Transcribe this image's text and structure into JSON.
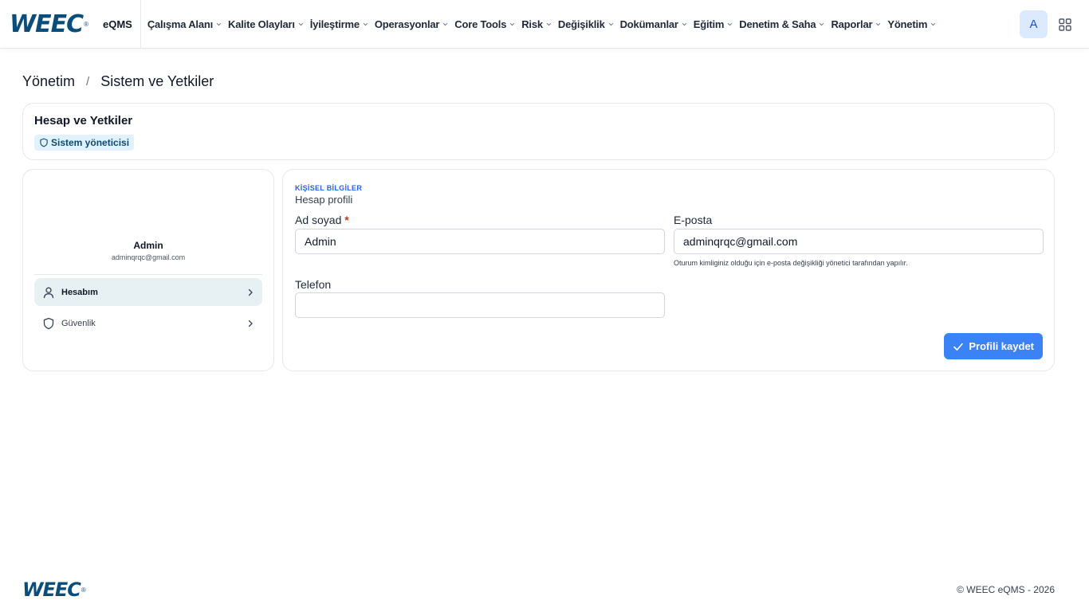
{
  "brand": {
    "logo": "WEEC",
    "app_name": "eQMS"
  },
  "nav": {
    "items": [
      "Çalışma Alanı",
      "Kalite Olayları",
      "İyileştirme",
      "Operasyonlar",
      "Core Tools",
      "Risk",
      "Değişiklik",
      "Dokümanlar",
      "Eğitim",
      "Denetim & Saha",
      "Raporlar",
      "Yönetim"
    ],
    "avatar_initial": "A",
    "apps_icon": "grid-icon"
  },
  "breadcrumb": {
    "parent": "Yönetim",
    "separator": "/",
    "current": "Sistem ve Yetkiler"
  },
  "header": {
    "title": "Hesap ve Yetkiler",
    "role_badge": "Sistem yöneticisi"
  },
  "profile": {
    "name": "Admin",
    "email": "adminqrqc@gmail.com",
    "menu": [
      {
        "label": "Hesabım",
        "icon": "user-icon",
        "active": true
      },
      {
        "label": "Güvenlik",
        "icon": "shield-icon",
        "active": false
      }
    ]
  },
  "form": {
    "kicker": "KİŞİSEL BİLGİLER",
    "title": "Hesap profili",
    "name_label": "Ad soyad",
    "required_mark": "*",
    "name_value": "Admin",
    "email_label": "E-posta",
    "email_value": "adminqrqc@gmail.com",
    "email_hint": "Oturum kimliginiz olduğu için e-posta değişikliği yönetici tarafından yapılır.",
    "phone_label": "Telefon",
    "phone_value": "",
    "save_label": "Profili kaydet"
  },
  "footer": {
    "logo": "WEEC",
    "copyright": "© WEEC eQMS - 2026"
  },
  "colors": {
    "brand": "#0b4d7a",
    "accent": "#3b82f6",
    "badge_bg": "#e0f2fe",
    "active_bg": "#e7f0f2"
  }
}
